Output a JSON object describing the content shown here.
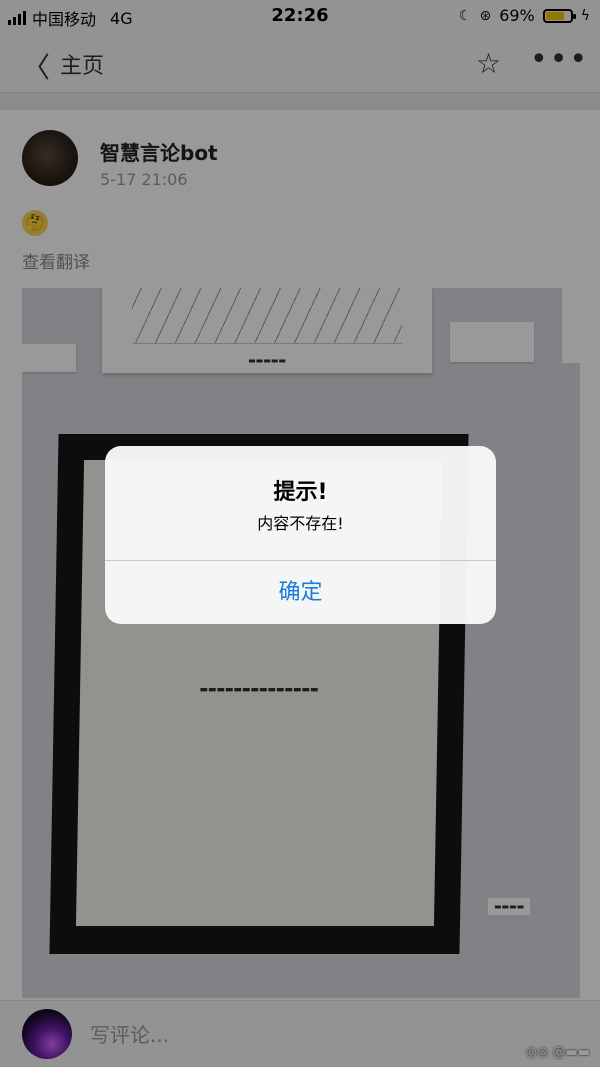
{
  "status_bar": {
    "carrier": "中国移动",
    "network": "4G",
    "time": "22:26",
    "battery_percent": "69%",
    "battery_level": 0.69,
    "battery_color": "#f5c400"
  },
  "navbar": {
    "back_icon": "chevron-left-icon",
    "title": "主页",
    "favorite_icon": "star-icon",
    "more_icon": "more-icon"
  },
  "post": {
    "username": "智慧言论bot",
    "time": "5-17 21:06",
    "emoji_icon": "thinking-face-icon",
    "translate_label": "查看翻译"
  },
  "alert": {
    "title": "提示!",
    "message": "内容不存在!",
    "confirm_label": "确定",
    "confirm_color": "#1b7bdc"
  },
  "comment_bar": {
    "placeholder": "写评论..."
  }
}
